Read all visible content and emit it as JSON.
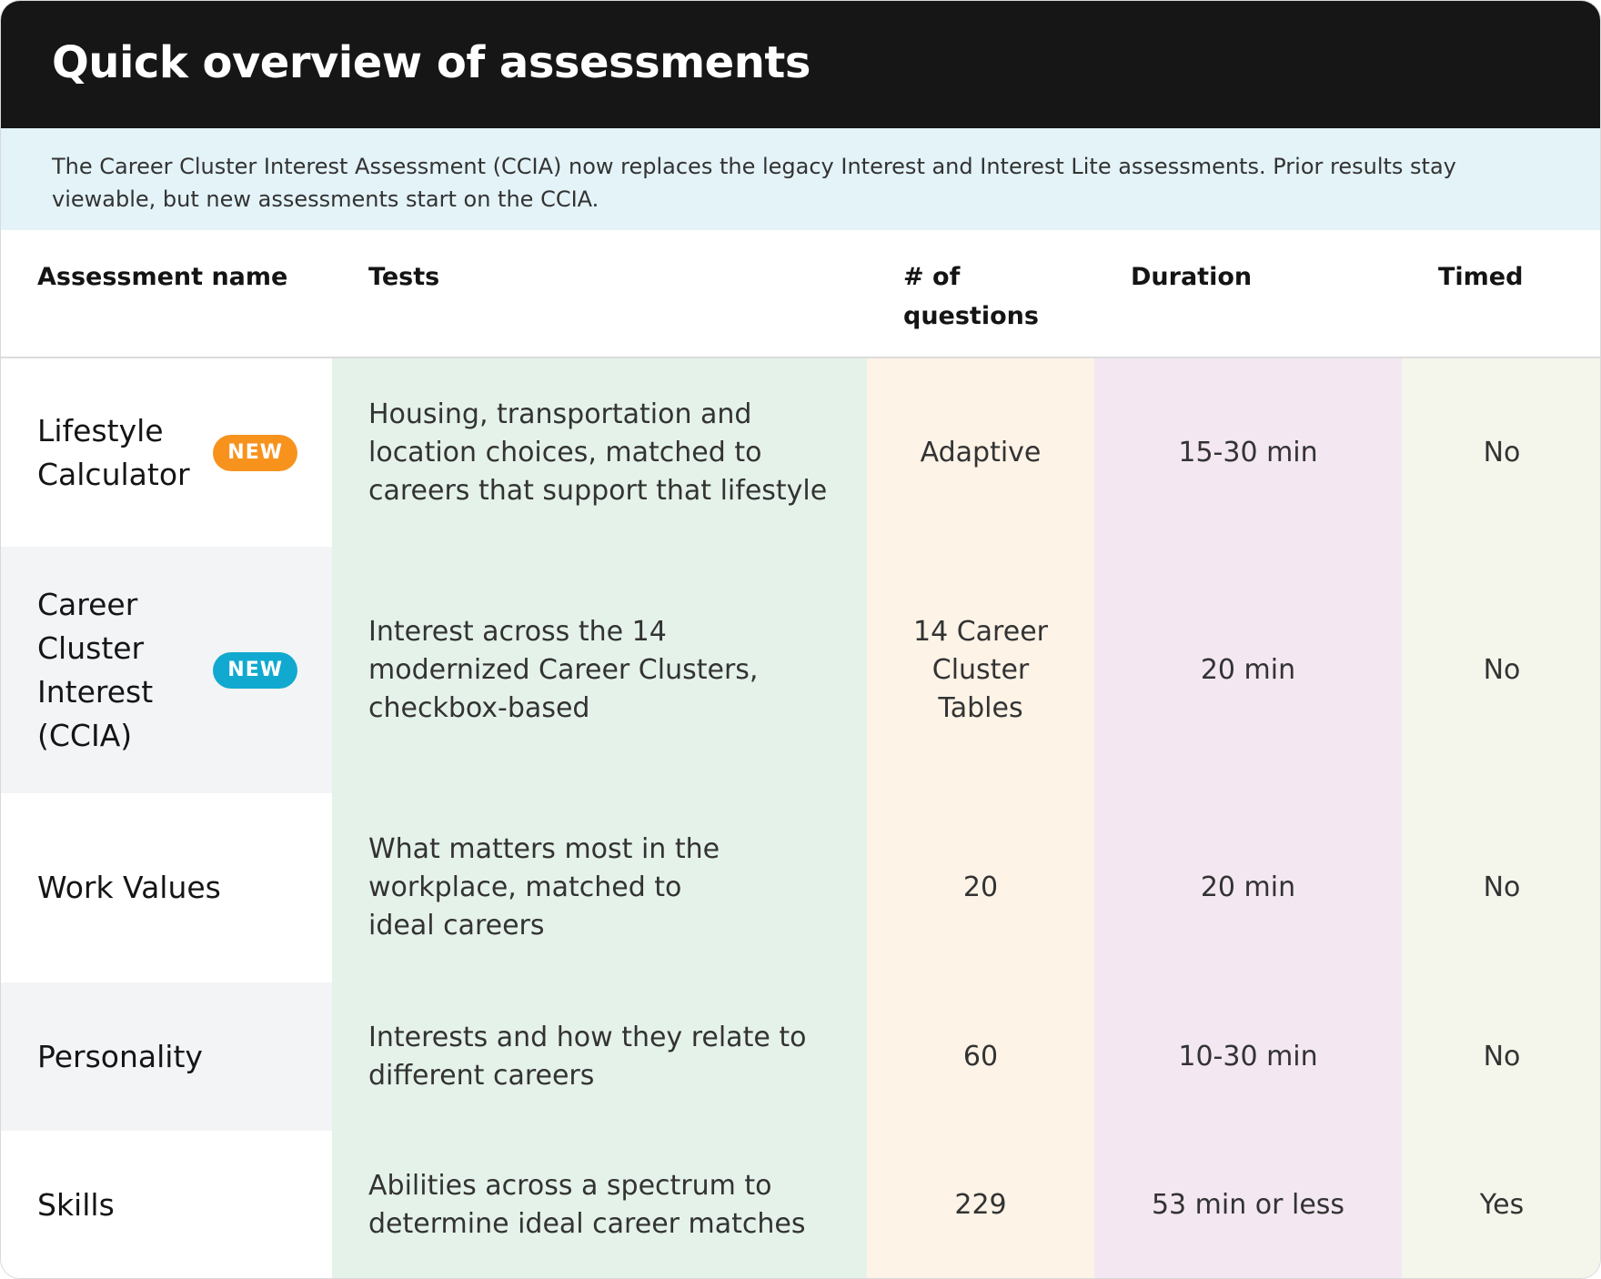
{
  "header": {
    "title": "Quick overview of assessments"
  },
  "notice": {
    "text": "The Career Cluster Interest Assessment (CCIA) now replaces the legacy Interest and Interest Lite assessments. Prior results stay viewable, but new assessments start on the CCIA."
  },
  "table": {
    "columns": [
      "Assessment name",
      "Tests",
      "# of questions",
      "Duration",
      "Timed"
    ],
    "rows": [
      {
        "name": "Lifestyle Calculator",
        "badge": "NEW",
        "badge_color": "#f7931d",
        "tests": "Housing, transportation and location choices, matched to careers that support that lifestyle",
        "questions": "Adaptive",
        "duration": "15-30 min",
        "timed": "No"
      },
      {
        "name": "Career Cluster Interest (CCIA)",
        "badge": "NEW",
        "badge_color": "#11a9cf",
        "tests": "Interest across the 14 modernized Career Clusters, checkbox-based",
        "questions": "14 Career Cluster Tables",
        "duration": "20 min",
        "timed": "No"
      },
      {
        "name": "Work Values",
        "badge": "",
        "tests": "What matters most in the workplace, matched to ideal careers",
        "questions": "20",
        "duration": "20 min",
        "timed": "No"
      },
      {
        "name": "Personality",
        "badge": "",
        "tests": "Interests and how they relate to different careers",
        "questions": "60",
        "duration": "10-30 min",
        "timed": "No"
      },
      {
        "name": "Skills",
        "badge": "",
        "tests": "Abilities across a spectrum to determine ideal career matches",
        "questions": "229",
        "duration": "53 min or less",
        "timed": "Yes"
      }
    ]
  },
  "colors": {
    "header_bg": "#161616",
    "notice_bg": "#e3f3f8",
    "tests_col_bg": "#e5f2ea",
    "questions_col_bg": "#fdf3e7",
    "duration_col_bg": "#f3e7f2",
    "timed_col_bg": "#f4f6eb"
  }
}
